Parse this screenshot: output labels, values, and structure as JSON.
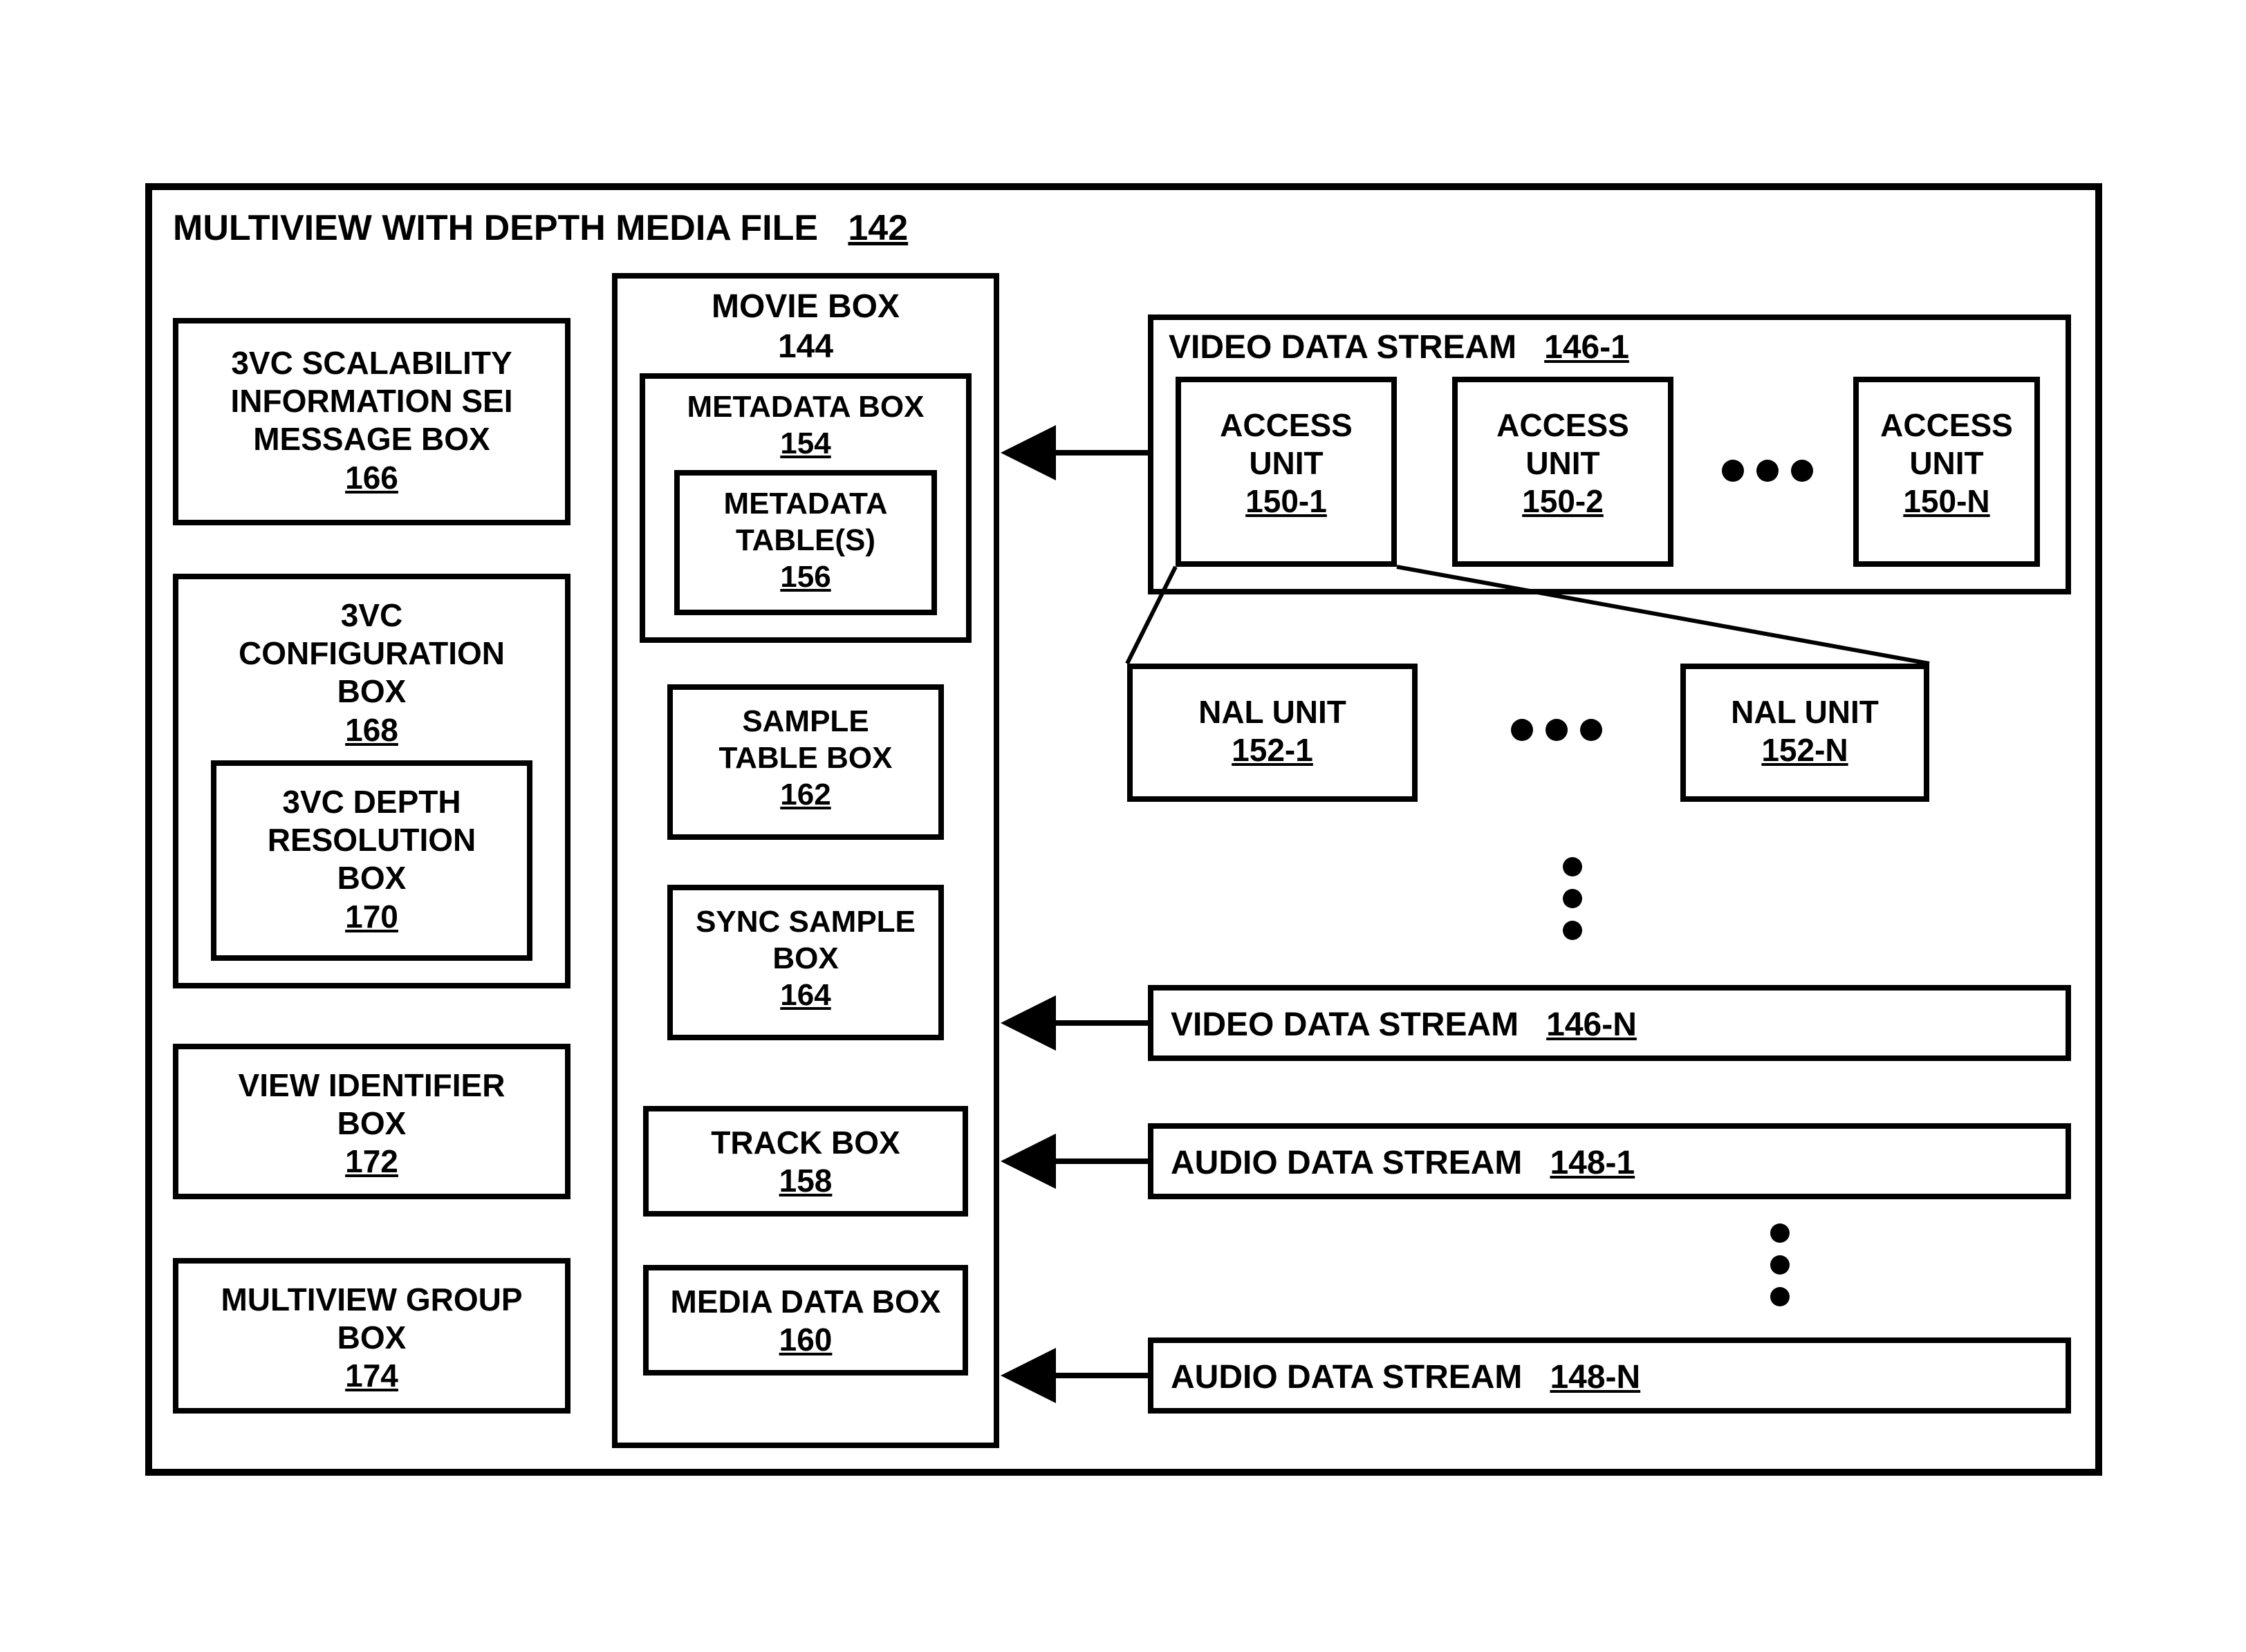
{
  "outer": {
    "title": "MULTIVIEW WITH DEPTH MEDIA FILE",
    "ref": "142"
  },
  "left": {
    "sei": {
      "l1": "3VC SCALABILITY",
      "l2": "INFORMATION SEI",
      "l3": "MESSAGE BOX",
      "ref": "166"
    },
    "cfg": {
      "l1": "3VC",
      "l2": "CONFIGURATION",
      "l3": "BOX",
      "ref": "168"
    },
    "depth": {
      "l1": "3VC DEPTH",
      "l2": "RESOLUTION",
      "l3": "BOX",
      "ref": "170"
    },
    "view": {
      "l1": "VIEW IDENTIFIER",
      "l2": "BOX",
      "ref": "172"
    },
    "grp": {
      "l1": "MULTIVIEW GROUP",
      "l2": "BOX",
      "ref": "174"
    }
  },
  "movie": {
    "title": "MOVIE BOX",
    "ref": "144",
    "meta": {
      "title": "METADATA BOX",
      "ref": "154"
    },
    "tables": {
      "l1": "METADATA",
      "l2": "TABLE(S)",
      "ref": "156"
    },
    "sample": {
      "l1": "SAMPLE",
      "l2": "TABLE BOX",
      "ref": "162"
    },
    "sync": {
      "l1": "SYNC SAMPLE",
      "l2": "BOX",
      "ref": "164"
    },
    "track": {
      "l1": "TRACK BOX",
      "ref": "158"
    },
    "media": {
      "l1": "MEDIA DATA BOX",
      "ref": "160"
    }
  },
  "streams": {
    "video1": {
      "title": "VIDEO DATA STREAM",
      "ref": "146-1"
    },
    "videoN": {
      "title": "VIDEO DATA STREAM",
      "ref": "146-N"
    },
    "audio1": {
      "title": "AUDIO DATA STREAM",
      "ref": "148-1"
    },
    "audioN": {
      "title": "AUDIO DATA STREAM",
      "ref": "148-N"
    }
  },
  "au": {
    "a1": {
      "l1": "ACCESS",
      "l2": "UNIT",
      "ref": "150-1"
    },
    "a2": {
      "l1": "ACCESS",
      "l2": "UNIT",
      "ref": "150-2"
    },
    "an": {
      "l1": "ACCESS",
      "l2": "UNIT",
      "ref": "150-N"
    }
  },
  "nal": {
    "n1": {
      "l1": "NAL UNIT",
      "ref": "152-1"
    },
    "nn": {
      "l1": "NAL UNIT",
      "ref": "152-N"
    }
  }
}
